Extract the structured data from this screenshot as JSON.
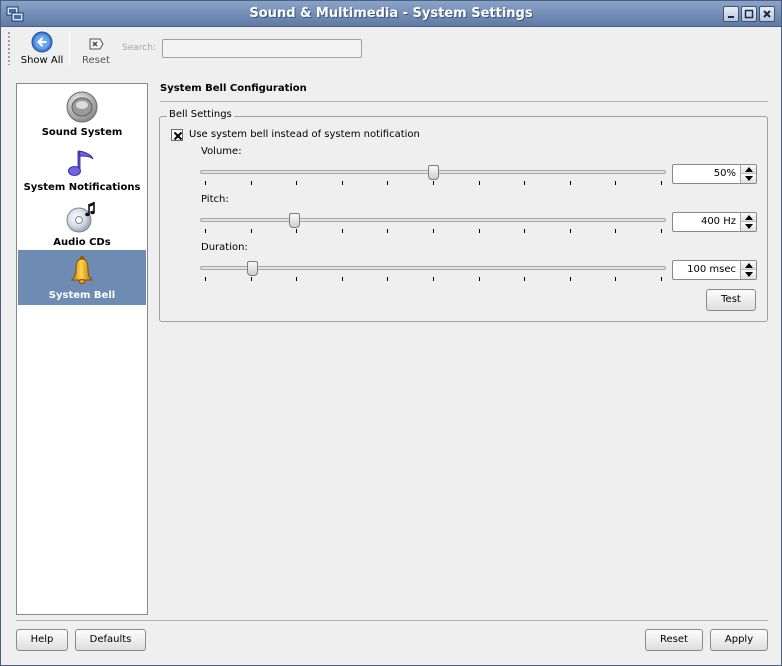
{
  "window": {
    "title": "Sound & Multimedia - System Settings"
  },
  "toolbar": {
    "show_all_label": "Show All",
    "reset_label": "Reset",
    "search_label": "Search:",
    "search_value": ""
  },
  "sidebar": {
    "items": [
      {
        "label": "Sound System",
        "icon": "speaker-icon",
        "selected": false
      },
      {
        "label": "System Notifications",
        "icon": "music-note-icon",
        "selected": false
      },
      {
        "label": "Audio CDs",
        "icon": "audio-cd-icon",
        "selected": false
      },
      {
        "label": "System Bell",
        "icon": "bell-icon",
        "selected": true
      }
    ]
  },
  "content": {
    "title": "System Bell Configuration",
    "group_title": "Bell Settings",
    "use_bell": {
      "label": "Use system bell instead of system notification",
      "checked": true
    },
    "volume": {
      "label": "Volume:",
      "value": "50%",
      "level": 0.5
    },
    "pitch": {
      "label": "Pitch:",
      "value": "400 Hz",
      "level": 0.2
    },
    "duration": {
      "label": "Duration:",
      "value": "100 msec",
      "level": 0.11
    },
    "test_label": "Test"
  },
  "footer": {
    "help_label": "Help",
    "defaults_label": "Defaults",
    "reset_label": "Reset",
    "apply_label": "Apply"
  },
  "colors": {
    "titlebar": "#5e7ba5",
    "selection": "#6e8cb3",
    "background": "#efefef"
  }
}
